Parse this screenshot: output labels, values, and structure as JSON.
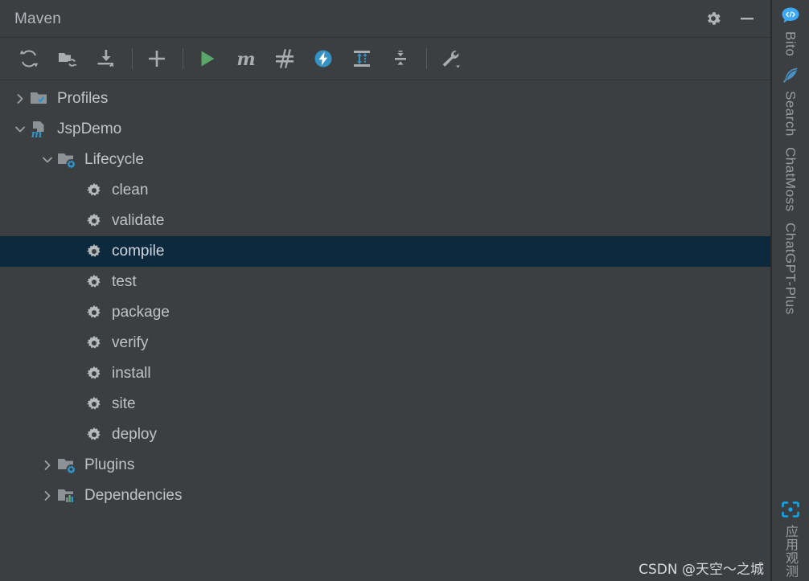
{
  "window": {
    "title": "Maven",
    "actions": [
      {
        "name": "settings-icon",
        "label": "Settings"
      },
      {
        "name": "hide-icon",
        "label": "Hide"
      }
    ]
  },
  "toolbar": {
    "buttons": [
      {
        "name": "reload-all-projects-icon",
        "label": "Reload All Maven Projects"
      },
      {
        "name": "add-maven-projects-icon",
        "label": "Add Maven Projects"
      },
      {
        "name": "download-sources-icon",
        "label": "Download Sources and/or Documentation"
      },
      {
        "name": "separator-1",
        "label": ""
      },
      {
        "name": "add-icon",
        "label": "Add"
      },
      {
        "name": "separator-2",
        "label": ""
      },
      {
        "name": "run-icon",
        "label": "Run Maven Build"
      },
      {
        "name": "execute-maven-goal-icon",
        "label": "Execute Maven Goal"
      },
      {
        "name": "toggle-skip-tests-icon",
        "label": "Toggle Skip Tests Mode"
      },
      {
        "name": "toggle-offline-icon",
        "label": "Toggle Offline Mode"
      },
      {
        "name": "expand-all-icon",
        "label": "Expand All"
      },
      {
        "name": "collapse-all-icon",
        "label": "Collapse All"
      },
      {
        "name": "separator-3",
        "label": ""
      },
      {
        "name": "maven-settings-icon",
        "label": "Maven Settings"
      }
    ]
  },
  "tree": {
    "rows": [
      {
        "label": "Profiles",
        "level": 0,
        "twisty": "collapsed",
        "icon": "profiles-folder-icon",
        "selected": false
      },
      {
        "label": "JspDemo",
        "level": 0,
        "twisty": "expanded",
        "icon": "maven-module-icon",
        "selected": false
      },
      {
        "label": "Lifecycle",
        "level": 1,
        "twisty": "expanded",
        "icon": "lifecycle-folder-icon",
        "selected": false
      },
      {
        "label": "clean",
        "level": 2,
        "twisty": "none",
        "icon": "phase-gear-icon",
        "selected": false
      },
      {
        "label": "validate",
        "level": 2,
        "twisty": "none",
        "icon": "phase-gear-icon",
        "selected": false
      },
      {
        "label": "compile",
        "level": 2,
        "twisty": "none",
        "icon": "phase-gear-icon",
        "selected": true
      },
      {
        "label": "test",
        "level": 2,
        "twisty": "none",
        "icon": "phase-gear-icon",
        "selected": false
      },
      {
        "label": "package",
        "level": 2,
        "twisty": "none",
        "icon": "phase-gear-icon",
        "selected": false
      },
      {
        "label": "verify",
        "level": 2,
        "twisty": "none",
        "icon": "phase-gear-icon",
        "selected": false
      },
      {
        "label": "install",
        "level": 2,
        "twisty": "none",
        "icon": "phase-gear-icon",
        "selected": false
      },
      {
        "label": "site",
        "level": 2,
        "twisty": "none",
        "icon": "phase-gear-icon",
        "selected": false
      },
      {
        "label": "deploy",
        "level": 2,
        "twisty": "none",
        "icon": "phase-gear-icon",
        "selected": false
      },
      {
        "label": "Plugins",
        "level": 1,
        "twisty": "collapsed",
        "icon": "plugins-folder-icon",
        "selected": false
      },
      {
        "label": "Dependencies",
        "level": 1,
        "twisty": "collapsed",
        "icon": "dependencies-folder-icon",
        "selected": false
      }
    ]
  },
  "sidebar": {
    "items": [
      {
        "label": "Bito",
        "icon": "bito-icon",
        "lang": "en"
      },
      {
        "label": "Search",
        "icon": "feather-icon",
        "lang": "en"
      },
      {
        "label": "ChatMoss",
        "icon": "none",
        "lang": "en"
      },
      {
        "label": "ChatGPT-Plus",
        "icon": "none",
        "lang": "en"
      },
      {
        "label": "应用观测",
        "icon": "arms-icon",
        "lang": "cn"
      }
    ]
  },
  "watermark": {
    "text": "CSDN @天空～之城"
  },
  "colors": {
    "background": "#3c3f41",
    "selection": "#0d293e",
    "text": "#c0c3c6",
    "title_text": "#b4b7bb",
    "icon_gray": "#9aa0a6",
    "accent_blue": "#3592c4",
    "accent_green": "#59a869",
    "separator": "#323232"
  }
}
